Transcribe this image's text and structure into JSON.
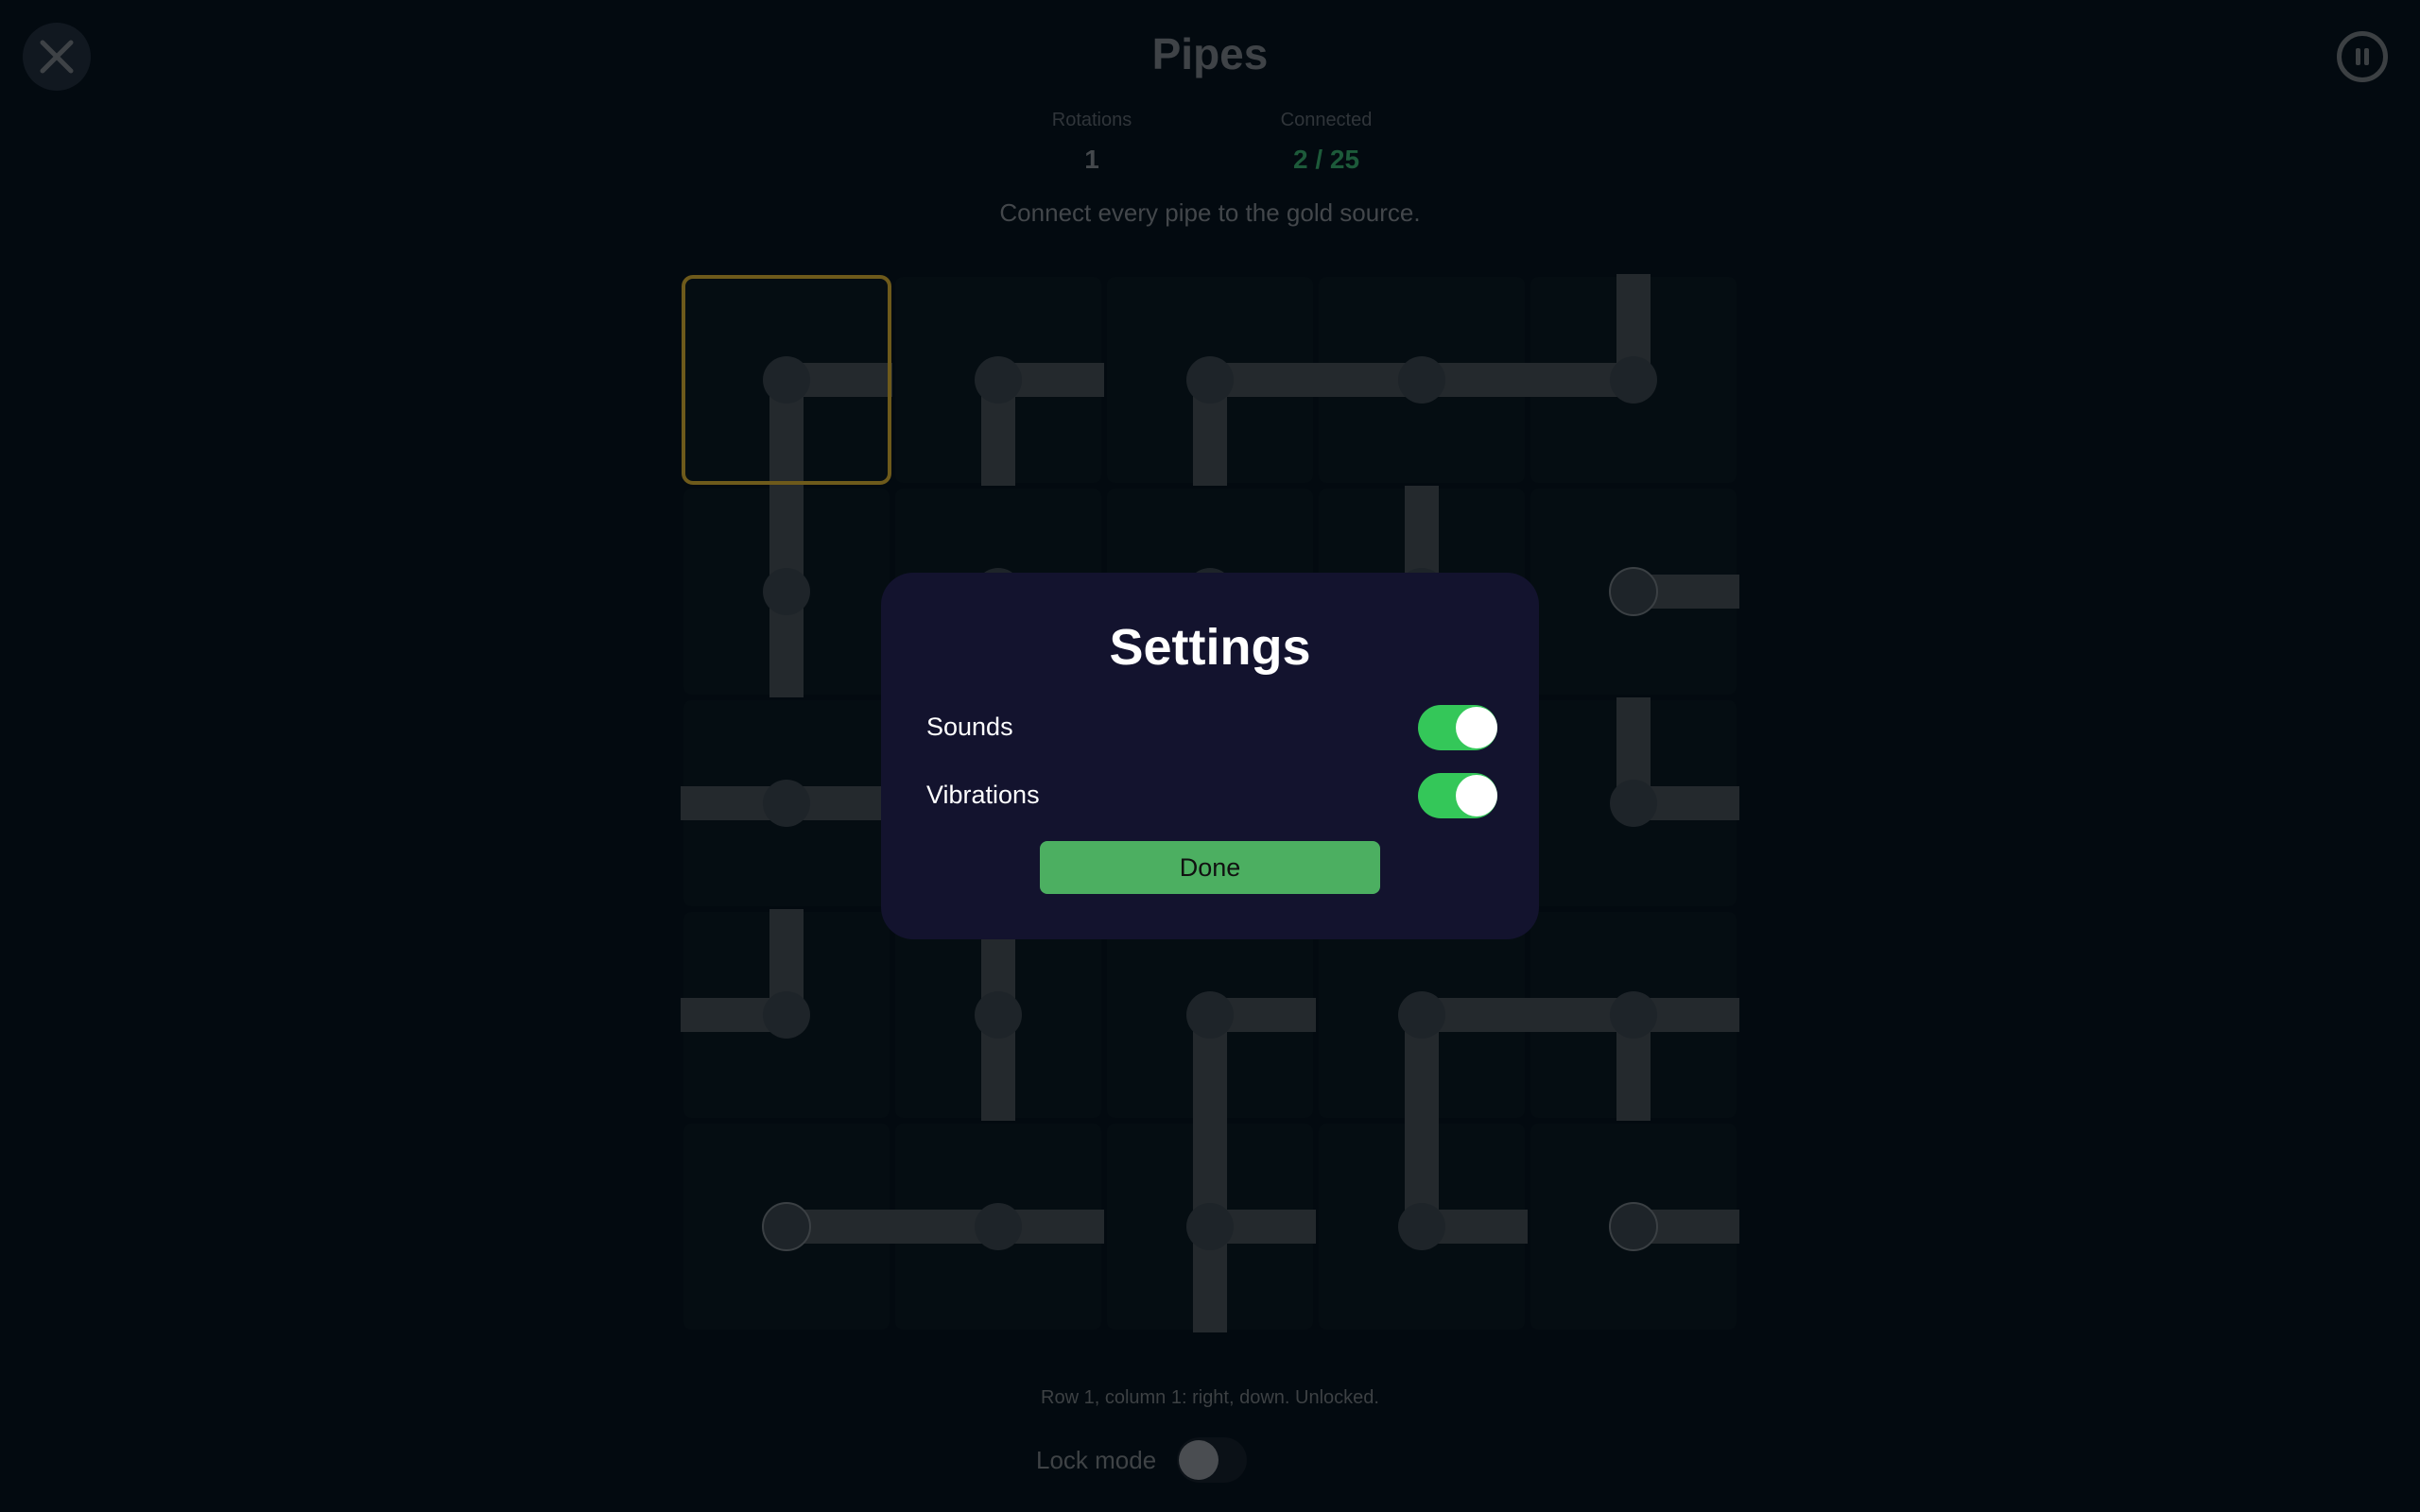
{
  "header": {
    "title": "Pipes",
    "close_icon": "close-icon",
    "pause_icon": "pause-icon"
  },
  "stats": {
    "rotations_label": "Rotations",
    "rotations_value": "1",
    "connected_label": "Connected",
    "connected_value": "2 / 25"
  },
  "instruction": "Connect every pipe to the gold source.",
  "board": {
    "rows": 5,
    "cols": 5,
    "selected": [
      0,
      0
    ],
    "colors": {
      "tile": "#050d12",
      "pipe": "#24292d",
      "endpoint": "#1e2429",
      "endpoint_stroke": "#3b4044",
      "selection": "#6e5a1b"
    },
    "tiles": [
      [
        "right,down",
        "right,down",
        "right,down",
        "left,right",
        "left,up"
      ],
      [
        "up,down",
        "right,down",
        "right,down",
        "up,down",
        "right"
      ],
      [
        "left,right",
        "up,right",
        "up,left",
        "left,right",
        "up,right"
      ],
      [
        "left,up",
        "up,down",
        "right,down",
        "right,down",
        "left,right,down"
      ],
      [
        "right",
        "left,right",
        "up,right,down",
        "up,right",
        "right"
      ]
    ],
    "endpoints": [
      [
        1,
        4
      ],
      [
        4,
        0
      ],
      [
        4,
        4
      ]
    ]
  },
  "status_text": "Row 1, column 1: right, down. Unlocked.",
  "lock_mode": {
    "label": "Lock mode",
    "on": false
  },
  "settings": {
    "title": "Settings",
    "sounds_label": "Sounds",
    "sounds_on": true,
    "vibrations_label": "Vibrations",
    "vibrations_on": true,
    "done_label": "Done",
    "accent_color": "#34c759",
    "done_color": "#4caf61"
  }
}
